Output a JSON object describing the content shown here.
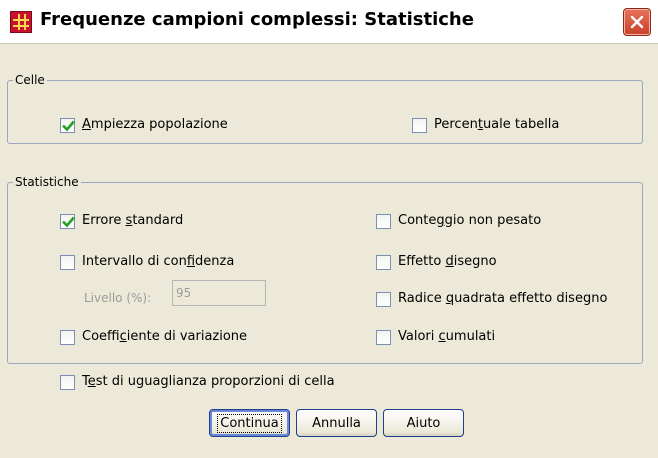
{
  "dialog": {
    "title": "Frequenze campioni complessi: Statistiche"
  },
  "cells": {
    "legend": "Celle",
    "population_size": {
      "pre": "",
      "key": "A",
      "post": "mpiezza popolazione",
      "checked": true
    },
    "table_percent": {
      "pre": "Percen",
      "key": "t",
      "post": "uale tabella",
      "checked": false
    }
  },
  "statistics": {
    "legend": "Statistiche",
    "standard_error": {
      "pre": "Errore ",
      "key": "s",
      "post": "tandard",
      "checked": true
    },
    "confidence_interval": {
      "pre": "Intervallo di con",
      "key": "f",
      "post": "idenza",
      "checked": false
    },
    "level_label": "Livello (%):",
    "level_value": "95",
    "coefficient_variation": {
      "pre": "Coeffi",
      "key": "c",
      "post": "iente di variazione",
      "checked": false
    },
    "unweighted_count": {
      "pre": "Conte",
      "key": "g",
      "post": "gio non pesato",
      "checked": false
    },
    "design_effect": {
      "pre": "Effetto ",
      "key": "d",
      "post": "isegno",
      "checked": false
    },
    "sqrt_design_effect": {
      "pre": "Radice ",
      "key": "q",
      "post": "uadrata effetto disegno",
      "checked": false
    },
    "cumulative_values": {
      "pre": "Valori ",
      "key": "c",
      "post": "umulati",
      "checked": false
    }
  },
  "equality_test": {
    "pre": "T",
    "key": "e",
    "post": "st di uguaglianza proporzioni di cella",
    "checked": false
  },
  "buttons": {
    "continue": "Continua",
    "cancel": "Annulla",
    "help": "Aiuto"
  },
  "colors": {
    "dialog_background": "#ece9d8",
    "close_button": "#d6553e",
    "checkmark": "#21a121"
  }
}
